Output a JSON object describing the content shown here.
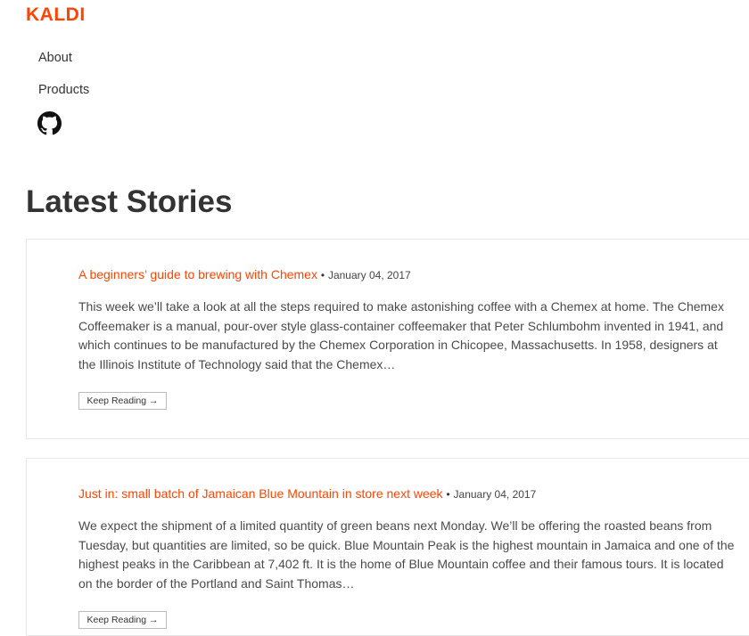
{
  "brand": {
    "logo_text": "KALDI",
    "accent_color": "#ff4400"
  },
  "nav": {
    "items": [
      {
        "label": "About"
      },
      {
        "label": "Products"
      }
    ],
    "github_icon": "github-icon"
  },
  "main": {
    "title": "Latest Stories",
    "stories": [
      {
        "title": "A beginners’ guide to brewing with Chemex",
        "separator": "•",
        "date": "January 04, 2017",
        "excerpt": "This week we’ll take a look at all the steps required to make astonishing coffee with a Chemex at home. The Chemex Coffeemaker is a manual, pour-over style glass-container coffeemaker that Peter Schlumbohm invented in 1941, and which continues to be manufactured by the Chemex Corporation in Chicopee, Massachusetts. In 1958, designers at the Illinois Institute of Technology said that the Chemex…",
        "button_label": "Keep Reading →"
      },
      {
        "title": "Just in: small batch of Jamaican Blue Mountain in store next week",
        "separator": "•",
        "date": "January 04, 2017",
        "excerpt": "We expect the shipment of a limited quantity of green beans next Monday. We’ll be offering the roasted beans from Tuesday, but quantities are limited, so be quick. Blue Mountain Peak is the highest mountain in Jamaica and one of the highest peaks in the Caribbean at 7,402 ft. It is the home of Blue Mountain coffee and their famous tours. It is located on the border of the Portland and Saint Thomas…",
        "button_label": "Keep Reading →"
      }
    ]
  }
}
